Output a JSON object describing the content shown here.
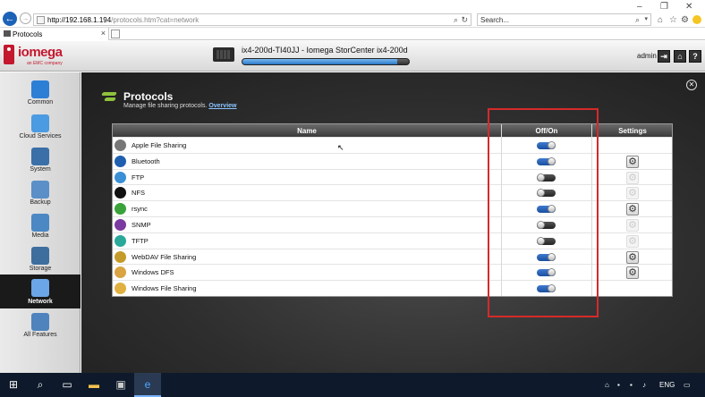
{
  "browser": {
    "url_host": "http://192.168.1.194",
    "url_path": "/protocols.htm?cat=network",
    "search_placeholder": "Search...",
    "tab_title": "Protocols"
  },
  "header": {
    "logo": "iomega",
    "logo_sub": "an EMC company",
    "device_name": "ix4-200d-TI40JJ - Iomega StorCenter ix4-200d",
    "capacity_fraction": 0.93,
    "user": "admin"
  },
  "sidebar": {
    "items": [
      {
        "label": "Common",
        "icon": "star-icon",
        "color": "#2d7fd6"
      },
      {
        "label": "Cloud Services",
        "icon": "cloud-icon",
        "color": "#4a9be2"
      },
      {
        "label": "System",
        "icon": "gear-icon",
        "color": "#3a6fa8"
      },
      {
        "label": "Backup",
        "icon": "backup-icon",
        "color": "#5a8fc8"
      },
      {
        "label": "Media",
        "icon": "media-icon",
        "color": "#4c88c4"
      },
      {
        "label": "Storage",
        "icon": "storage-icon",
        "color": "#3d6e9e"
      },
      {
        "label": "Network",
        "icon": "network-icon",
        "color": "#6aa6e8"
      },
      {
        "label": "All Features",
        "icon": "grid-icon",
        "color": "#4f83bd"
      }
    ]
  },
  "main": {
    "title": "Protocols",
    "subtitle": "Manage file sharing protocols.",
    "overview_link": "Overview",
    "columns": {
      "name": "Name",
      "offon": "Off/On",
      "settings": "Settings"
    },
    "rows": [
      {
        "name": "Apple File Sharing",
        "on": true,
        "settings": "none",
        "icon_color": "#777"
      },
      {
        "name": "Bluetooth",
        "on": true,
        "settings": "enabled",
        "icon_color": "#1f5fb0"
      },
      {
        "name": "FTP",
        "on": false,
        "settings": "disabled",
        "icon_color": "#3b8fd4"
      },
      {
        "name": "NFS",
        "on": false,
        "settings": "disabled",
        "icon_color": "#111"
      },
      {
        "name": "rsync",
        "on": true,
        "settings": "enabled",
        "icon_color": "#3aa23a"
      },
      {
        "name": "SNMP",
        "on": false,
        "settings": "disabled",
        "icon_color": "#7a3aa0"
      },
      {
        "name": "TFTP",
        "on": false,
        "settings": "disabled",
        "icon_color": "#2aa89a"
      },
      {
        "name": "WebDAV File Sharing",
        "on": true,
        "settings": "enabled",
        "icon_color": "#c49a2a"
      },
      {
        "name": "Windows DFS",
        "on": true,
        "settings": "enabled",
        "icon_color": "#d9a441"
      },
      {
        "name": "Windows File Sharing",
        "on": true,
        "settings": "none",
        "icon_color": "#e0b040"
      }
    ]
  },
  "taskbar": {
    "language": "ENG"
  }
}
